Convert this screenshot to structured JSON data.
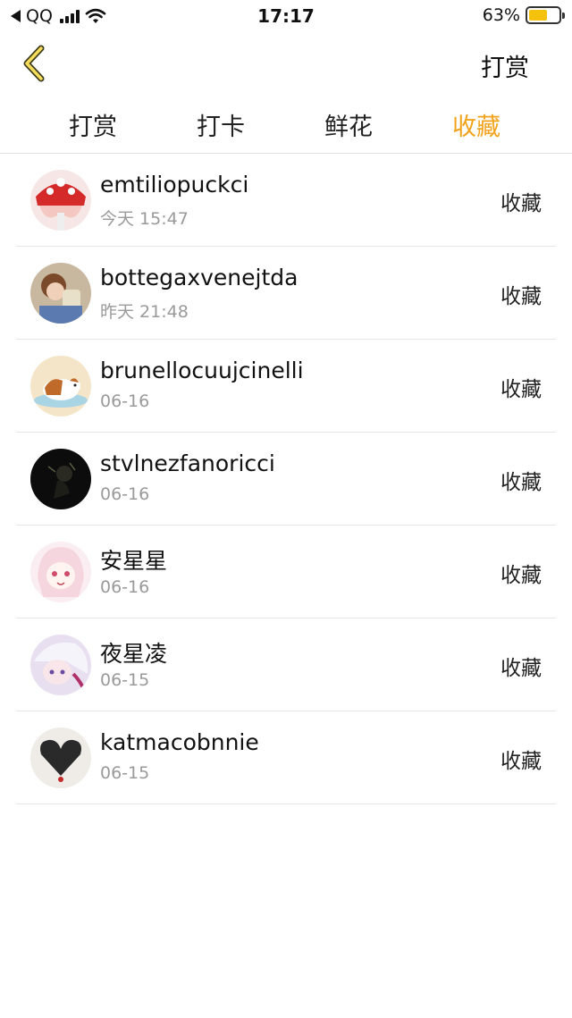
{
  "status_bar": {
    "carrier": "QQ",
    "time": "17:17",
    "battery_percent_text": "63%",
    "battery_level": 0.63,
    "battery_color": "#f4c20d"
  },
  "nav": {
    "back_icon": "chevron-left-icon",
    "action_label": "打赏"
  },
  "tabs": [
    {
      "label": "打赏",
      "active": false
    },
    {
      "label": "打卡",
      "active": false
    },
    {
      "label": "鲜花",
      "active": false
    },
    {
      "label": "收藏",
      "active": true
    }
  ],
  "accent_color": "#f2a31c",
  "list": [
    {
      "name": "emtiliopuckci",
      "time": "今天 15:47",
      "action": "收藏"
    },
    {
      "name": "bottegaxvenejtda",
      "time": "昨天 21:48",
      "action": "收藏"
    },
    {
      "name": "brunellocuujcinelli",
      "time": "06-16",
      "action": "收藏"
    },
    {
      "name": "stvlnezfanoricci",
      "time": "06-16",
      "action": "收藏"
    },
    {
      "name": "安星星",
      "time": "06-16",
      "action": "收藏"
    },
    {
      "name": "夜星凌",
      "time": "06-15",
      "action": "收藏"
    },
    {
      "name": "katmacobnnie",
      "time": "06-15",
      "action": "收藏"
    }
  ]
}
